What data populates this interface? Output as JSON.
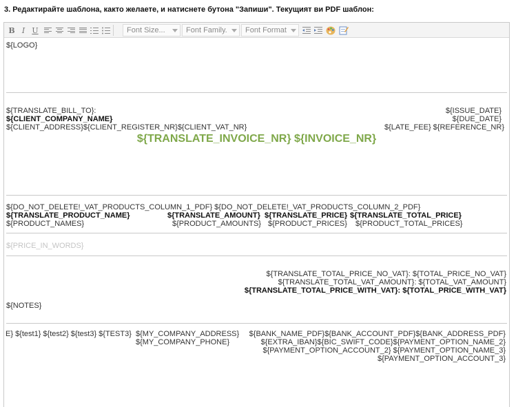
{
  "heading": "3. Редактирайте шаблона, както желаете, и натиснете бутона \"Запиши\". Текущият ви PDF шаблон:",
  "toolbar": {
    "bold": "B",
    "italic": "I",
    "underline": "U",
    "font_size": "Font Size...",
    "font_family": "Font Family.",
    "font_format": "Font Format"
  },
  "template": {
    "logo": "${LOGO}",
    "bill_to": "${TRANSLATE_BILL_TO}:",
    "client_company": "${CLIENT_COMPANY_NAME}",
    "client_address": "${CLIENT_ADDRESS}${CLIENT_REGISTER_NR}${CLIENT_VAT_NR}",
    "issue_date": "${ISSUE_DATE}",
    "due_date": "${DUE_DATE}",
    "late_fee_ref": "${LATE_FEE} ${REFERENCE_NR}",
    "invoice_title": "${TRANSLATE_INVOICE_NR} ${INVOICE_NR}",
    "vat_columns": "${DO_NOT_DELETE!_VAT_PRODUCTS_COLUMN_1_PDF} ${DO_NOT_DELETE!_VAT_PRODUCTS_COLUMN_2_PDF}",
    "product_header": {
      "name": "${TRANSLATE_PRODUCT_NAME}",
      "amount": "${TRANSLATE_AMOUNT}",
      "price": "${TRANSLATE_PRICE}",
      "total": "${TRANSLATE_TOTAL_PRICE}"
    },
    "product_row": {
      "name": "${PRODUCT_NAMES}",
      "amount": "${PRODUCT_AMOUNTS}",
      "price": "${PRODUCT_PRICES}",
      "total": "${PRODUCT_TOTAL_PRICES}"
    },
    "price_in_words": "${PRICE_IN_WORDS}",
    "total_no_vat": "${TRANSLATE_TOTAL_PRICE_NO_VAT}: ${TOTAL_PRICE_NO_VAT}",
    "total_vat": "${TRANSLATE_TOTAL_VAT_AMOUNT}: ${TOTAL_VAT_AMOUNT}",
    "total_with_vat": "${TRANSLATE_TOTAL_PRICE_WITH_VAT}: ${TOTAL_PRICE_WITH_VAT}",
    "notes": "${NOTES}",
    "footer": {
      "tests": "E} ${test1} ${test2} ${test3} ${TEST3}",
      "company_address": "${MY_COMPANY_ADDRESS}",
      "company_phone": "${MY_COMPANY_PHONE}",
      "bank_line": "${BANK_NAME_PDF}${BANK_ACCOUNT_PDF}${BANK_ADDRESS_PDF}",
      "iban_line": "${EXTRA_IBAN}${BIC_SWIFT_CODE}${PAYMENT_OPTION_NAME_2}",
      "payment_account_2": "${PAYMENT_OPTION_ACCOUNT_2} ${PAYMENT_OPTION_NAME_3}",
      "payment_account_3": "${PAYMENT_OPTION_ACCOUNT_3}"
    }
  },
  "colors": {
    "invoice_title": "#7fa84a",
    "toolbar_bg": "#f4f4f4",
    "divider": "#c8c8c8"
  }
}
